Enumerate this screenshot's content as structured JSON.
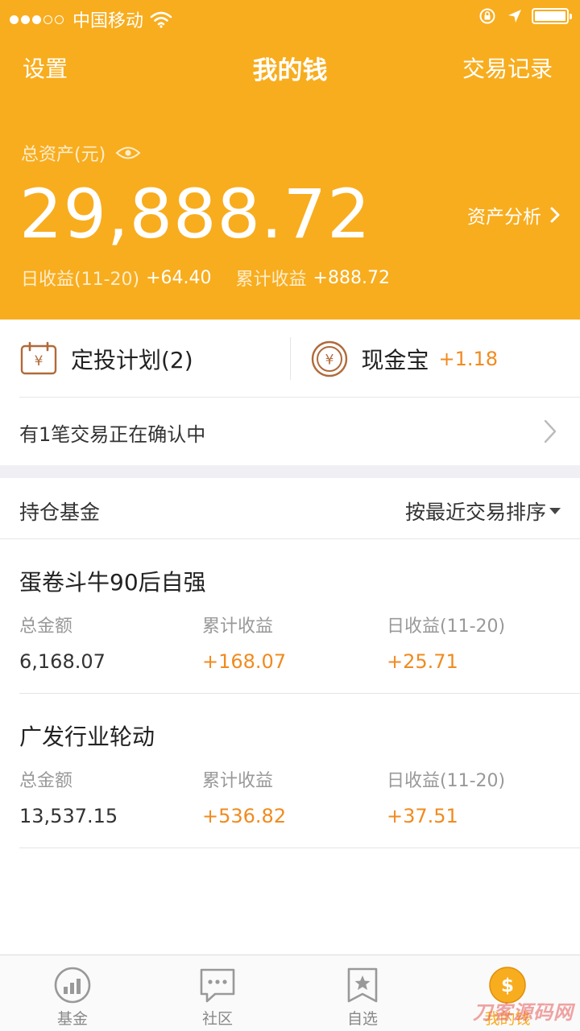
{
  "status_bar": {
    "carrier": "中国移动"
  },
  "nav": {
    "left": "设置",
    "title": "我的钱",
    "right": "交易记录"
  },
  "summary": {
    "total_label": "总资产(元)",
    "total_value": "29,888.72",
    "analysis_label": "资产分析",
    "daily_label": "日收益(11-20)",
    "daily_value": "+64.40",
    "cumulative_label": "累计收益",
    "cumulative_value": "+888.72"
  },
  "quick": {
    "plan_label": "定投计划(2)",
    "cash_label": "现金宝",
    "cash_gain": "+1.18"
  },
  "pending": {
    "text": "有1笔交易正在确认中"
  },
  "holdings": {
    "title": "持仓基金",
    "sort_label": "按最近交易排序",
    "metric_labels": {
      "total": "总金额",
      "cumulative": "累计收益",
      "daily": "日收益(11-20)"
    },
    "funds": [
      {
        "name": "蛋卷斗牛90后自强",
        "total": "6,168.07",
        "cumulative": "+168.07",
        "daily": "+25.71"
      },
      {
        "name": "广发行业轮动",
        "total": "13,537.15",
        "cumulative": "+536.82",
        "daily": "+37.51"
      }
    ]
  },
  "tabs": [
    {
      "label": "基金",
      "icon": "fund-chart-icon"
    },
    {
      "label": "社区",
      "icon": "chat-bubble-icon"
    },
    {
      "label": "自选",
      "icon": "bookmark-star-icon"
    },
    {
      "label": "我的钱",
      "icon": "coin-icon"
    }
  ],
  "watermark": "刀客源码网",
  "colors": {
    "brand": "#f8ad1e",
    "gain": "#f08b1f"
  }
}
